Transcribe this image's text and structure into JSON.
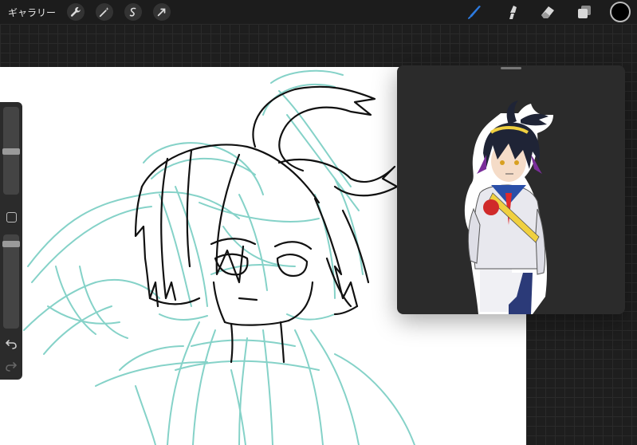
{
  "topbar": {
    "gallery_label": "ギャラリー",
    "left_tools": [
      "wrench-icon",
      "magic-wand-icon",
      "selection-icon",
      "transform-arrow-icon"
    ],
    "right_tools": [
      "brush-icon",
      "smudge-icon",
      "eraser-icon",
      "layers-icon"
    ],
    "active_tool": "brush-icon",
    "brush_color": "#2d7be0",
    "current_color": "#000000"
  },
  "sidebar": {
    "controls": [
      "brush-size-slider",
      "modify-button",
      "opacity-slider",
      "undo-icon",
      "redo-icon"
    ]
  },
  "reference_panel": {
    "title": ""
  }
}
